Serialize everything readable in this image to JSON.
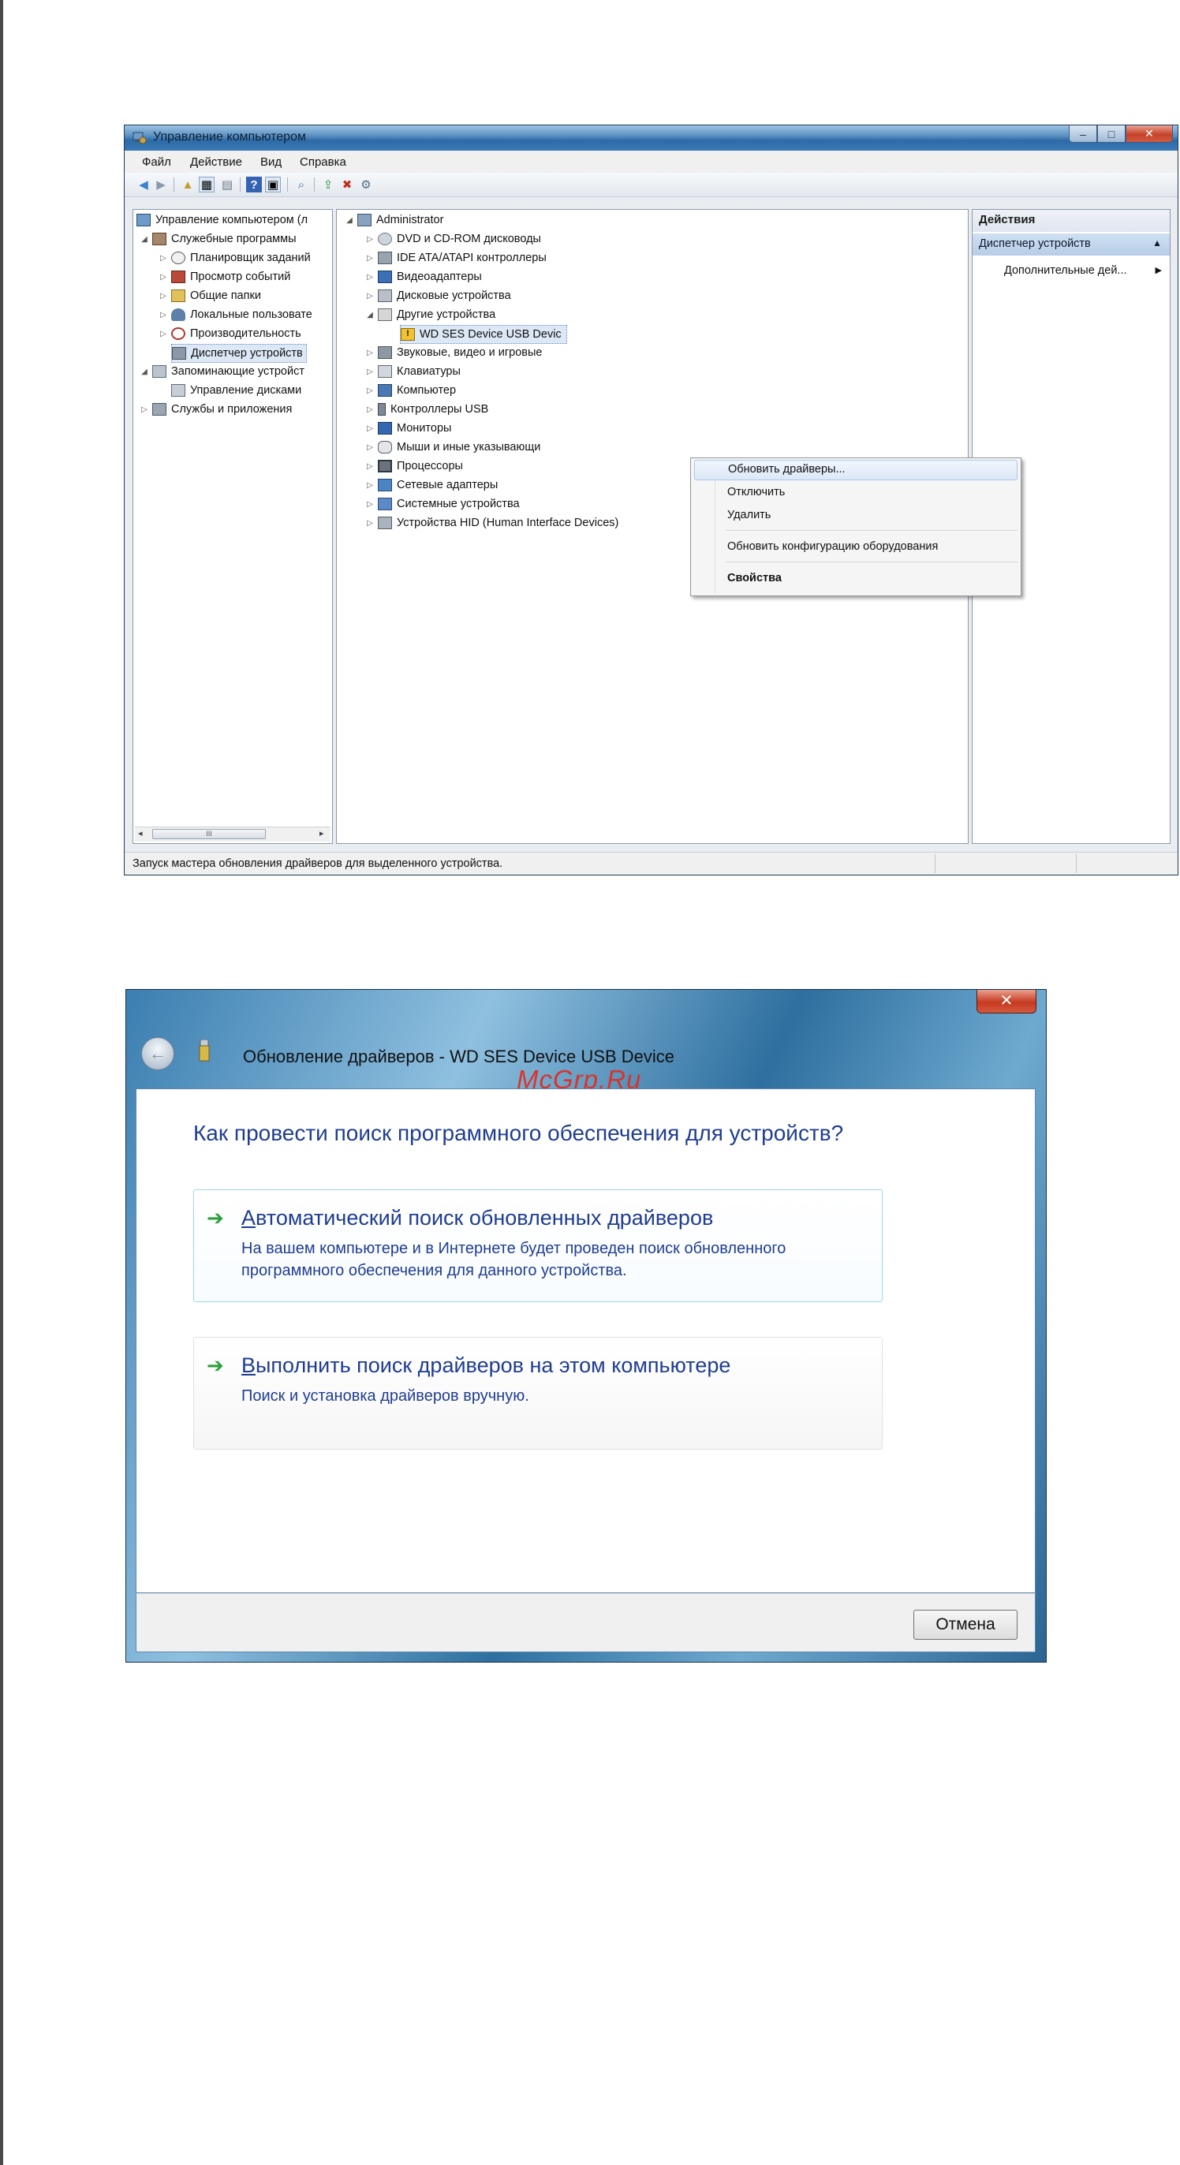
{
  "window1": {
    "title": "Управление компьютером",
    "menu": [
      "Файл",
      "Действие",
      "Вид",
      "Справка"
    ],
    "left_tree": [
      {
        "label": "Управление компьютером (л",
        "level": 0
      },
      {
        "label": "Служебные программы",
        "level": 1
      },
      {
        "label": "Планировщик заданий",
        "level": 2
      },
      {
        "label": "Просмотр событий",
        "level": 2
      },
      {
        "label": "Общие папки",
        "level": 2
      },
      {
        "label": "Локальные пользовате",
        "level": 2
      },
      {
        "label": "Производительность",
        "level": 2
      },
      {
        "label": "Диспетчер устройств",
        "level": 2
      },
      {
        "label": "Запоминающие устройст",
        "level": 1
      },
      {
        "label": "Управление дисками",
        "level": 2
      },
      {
        "label": "Службы и приложения",
        "level": 1
      }
    ],
    "device_tree": [
      {
        "label": "Administrator"
      },
      {
        "label": "DVD и CD-ROM дисководы"
      },
      {
        "label": "IDE ATA/ATAPI контроллеры"
      },
      {
        "label": "Видеоадаптеры"
      },
      {
        "label": "Дисковые устройства"
      },
      {
        "label": "Другие устройства"
      },
      {
        "label": "WD SES Device USB Devic"
      },
      {
        "label": "Звуковые, видео и игровые"
      },
      {
        "label": "Клавиатуры"
      },
      {
        "label": "Компьютер"
      },
      {
        "label": "Контроллеры USB"
      },
      {
        "label": "Мониторы"
      },
      {
        "label": "Мыши и иные указывающи"
      },
      {
        "label": "Процессоры"
      },
      {
        "label": "Сетевые адаптеры"
      },
      {
        "label": "Системные устройства"
      },
      {
        "label": "Устройства HID (Human Interface Devices)"
      }
    ],
    "context_menu": {
      "update": "Обновить драйверы...",
      "disable": "Отключить",
      "delete": "Удалить",
      "scan": "Обновить конфигурацию оборудования",
      "properties": "Свойства"
    },
    "actions": {
      "header": "Действия",
      "section": "Диспетчер устройств",
      "more": "Дополнительные дей..."
    },
    "scroll_thumb": "III",
    "status": "Запуск мастера обновления драйверов для выделенного устройства."
  },
  "window2": {
    "title": "Обновление драйверов - WD SES Device USB Device",
    "watermark": "McGrp.Ru",
    "heading": "Как провести поиск программного обеспечения для устройств?",
    "option1": {
      "accel": "А",
      "title_rest": "втоматический поиск обновленных драйверов",
      "desc": "На вашем компьютере и в Интернете будет проведен поиск обновленного программного обеспечения для данного устройства."
    },
    "option2": {
      "accel": "В",
      "title_rest": "ыполнить поиск драйверов на этом компьютере",
      "desc": "Поиск и установка драйверов вручную."
    },
    "close": "✕",
    "cancel": "Отмена"
  }
}
